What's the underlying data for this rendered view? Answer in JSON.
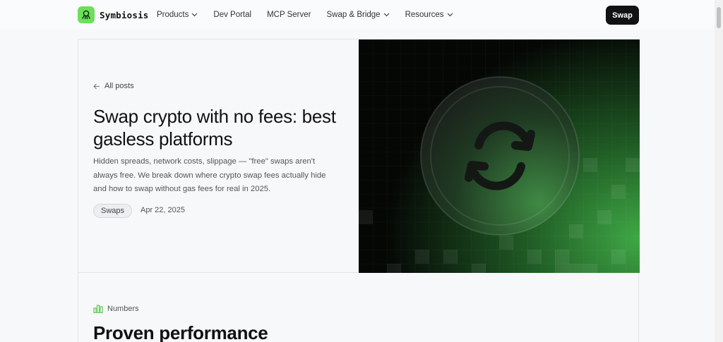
{
  "brand": {
    "name": "Symbiosis",
    "icon": "octopus-icon",
    "accent": "#6cdf5b"
  },
  "nav": {
    "items": [
      {
        "label": "Products",
        "dropdown": true
      },
      {
        "label": "Dev Portal",
        "dropdown": false
      },
      {
        "label": "MCP Server",
        "dropdown": false
      },
      {
        "label": "Swap & Bridge",
        "dropdown": true
      },
      {
        "label": "Resources",
        "dropdown": true
      }
    ],
    "cta_label": "Swap"
  },
  "hero": {
    "back_label": "All posts",
    "title": "Swap crypto with no fees: best gasless platforms",
    "description": "Hidden spreads, network costs, slippage — \"free\" swaps aren't always free. We break down where crypto swap fees actually hide and how to swap without gas fees for real in 2025.",
    "tag": "Swaps",
    "date": "Apr 22, 2025",
    "image_icon": "swap-arrows-coin-icon"
  },
  "numbers": {
    "label": "Numbers",
    "icon": "bar-chart-icon",
    "title": "Proven performance"
  }
}
